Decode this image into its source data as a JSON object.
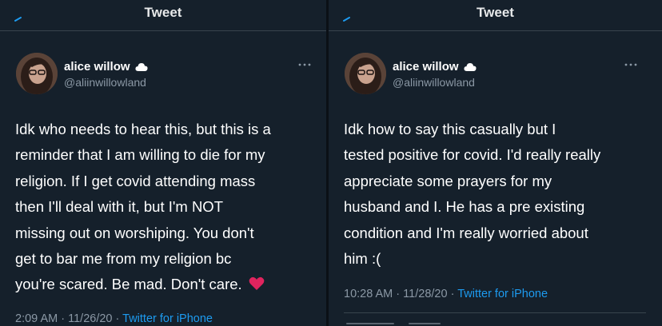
{
  "header_title": "Tweet",
  "left_tweet": {
    "display_name": "alice willow",
    "handle": "@aliinwillowland",
    "text_lines": [
      "Idk who needs to hear this, but this is a",
      "reminder that I am willing to die for my",
      "religion. If I get covid attending mass",
      "then I'll deal with it, but I'm NOT",
      "missing out on worshiping. You don't",
      "get to bar me from my religion bc",
      "you're scared. Be mad. Don't care."
    ],
    "time": "2:09 AM",
    "date": "11/26/20",
    "source": "Twitter for iPhone"
  },
  "right_tweet": {
    "display_name": "alice willow",
    "handle": "@aliinwillowland",
    "text_lines": [
      "Idk how to say this casually but I",
      "tested positive for covid. I'd really really",
      "appreciate some prayers for my",
      "husband and I. He has a pre existing",
      "condition and I'm really worried about",
      "him :("
    ],
    "time": "10:28 AM",
    "date": "11/28/20",
    "source": "Twitter for iPhone"
  },
  "icons": {
    "back": "back-arrow-icon",
    "cloud": "cloud-icon",
    "more": "more-options-icon",
    "heart": "red-heart-emoji"
  },
  "colors": {
    "background": "#15202b",
    "text": "#ffffff",
    "secondary": "#8b98a5",
    "link": "#1d9bf0",
    "divider": "#38444d",
    "heart": "#e0245e"
  },
  "separator": "·"
}
